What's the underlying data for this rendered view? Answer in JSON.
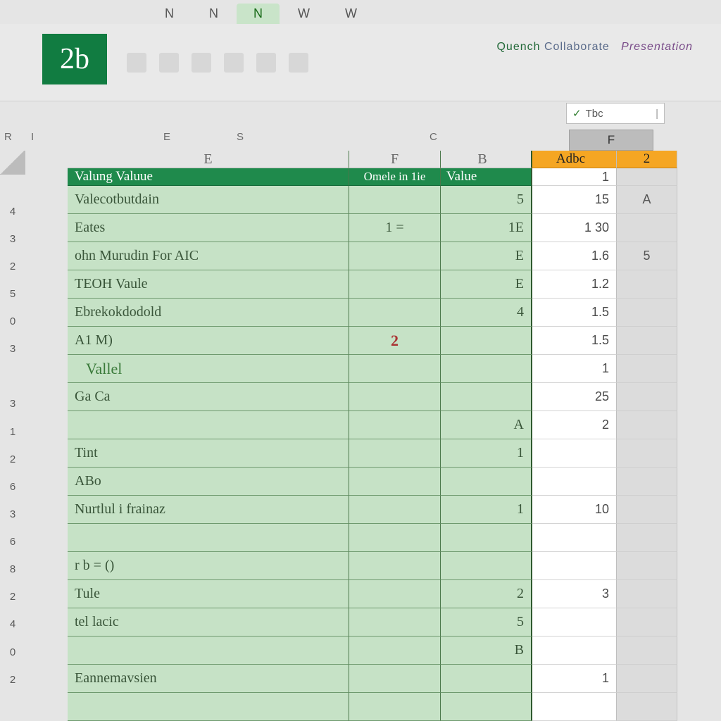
{
  "tabs": [
    "N",
    "N",
    "N",
    "W",
    "W"
  ],
  "active_tab_index": 2,
  "app_logo_text": "2b",
  "ribbon_hint_left": "Quench",
  "ribbon_hint_mid": "Collaborate",
  "ribbon_hint_right": "Presentation",
  "namebox": {
    "check": "✓",
    "label": "Tbc",
    "after": "|"
  },
  "mini_cols": {
    "R": "R",
    "I": "I",
    "E": "E",
    "S": "S",
    "C": "C"
  },
  "col_letters": {
    "gutter": "",
    "A": "E",
    "B": "F",
    "C": "B",
    "D": "",
    "E": ""
  },
  "selected_col_letter": "F",
  "orange_header_1": "Adbc",
  "orange_header_2": "2",
  "title_row": {
    "A": "Valung Valuue",
    "B": "Omele in",
    "B2": "1ie",
    "C": "Value",
    "D": "1"
  },
  "rows": [
    {
      "n": "4",
      "A": "Valecotbutdain",
      "B": "",
      "C": "5",
      "D": "15",
      "E": "A"
    },
    {
      "n": "3",
      "A": "Eates",
      "B": "1 =",
      "C": "1E",
      "D": "1 30",
      "E": ""
    },
    {
      "n": "2",
      "A": "ohn Murudin For AIC",
      "B": "",
      "C": "E",
      "D": "1.6",
      "E": "5"
    },
    {
      "n": "5",
      "A": "TEOH Vaule",
      "B": "",
      "C": "E",
      "D": "1.2",
      "E": ""
    },
    {
      "n": "0",
      "A": "Ebrekokdodold",
      "B": "",
      "C": "4",
      "D": "1.5",
      "E": ""
    },
    {
      "n": "3",
      "A": "A1 M)",
      "B": "2",
      "C": "",
      "D": "1.5",
      "E": "",
      "b_is_red": true
    },
    {
      "n": "",
      "A": "Vallel",
      "B": "",
      "C": "",
      "D": "1",
      "E": "",
      "indent": true
    },
    {
      "n": "3",
      "A": "Ga Ca",
      "B": "",
      "C": "",
      "D": "25",
      "E": ""
    },
    {
      "n": "1",
      "A": "",
      "B": "",
      "C": "A",
      "D": "2",
      "E": ""
    },
    {
      "n": "2",
      "A": "Tint",
      "B": "",
      "C": "1",
      "D": "",
      "E": ""
    },
    {
      "n": "6",
      "A": "ABo",
      "B": "",
      "C": "",
      "D": "",
      "E": ""
    },
    {
      "n": "3",
      "A": "Nurtlul i frainaz",
      "B": "",
      "C": "1",
      "D": "10",
      "E": ""
    },
    {
      "n": "6",
      "A": "",
      "B": "",
      "C": "",
      "D": "",
      "E": ""
    },
    {
      "n": "8",
      "A": "r   b = ()",
      "B": "",
      "C": "",
      "D": "",
      "E": ""
    },
    {
      "n": "2",
      "A": "Tule",
      "B": "",
      "C": "2",
      "D": "3",
      "E": ""
    },
    {
      "n": "4",
      "A": "tel   lacic",
      "B": "",
      "C": "5",
      "D": "",
      "E": ""
    },
    {
      "n": "0",
      "A": "",
      "B": "",
      "C": "B",
      "D": "",
      "E": ""
    },
    {
      "n": "2",
      "A": "Eannemavsien",
      "B": "",
      "C": "",
      "D": "1",
      "E": ""
    },
    {
      "n": "",
      "A": "",
      "B": "",
      "C": "",
      "D": "",
      "E": ""
    }
  ]
}
